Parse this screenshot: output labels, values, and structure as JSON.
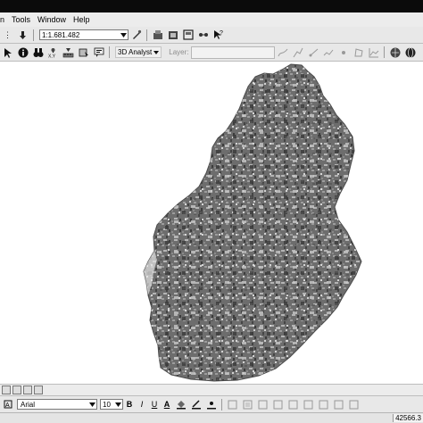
{
  "menu": {
    "items": [
      "n",
      "Tools",
      "Window",
      "Help"
    ]
  },
  "toolbar": {
    "scale_value": "1:1.681.482",
    "analyst_label": "3D Analyst",
    "layer_label": "Layer:"
  },
  "text_toolbar": {
    "font_value": "Arial",
    "size_value": "10",
    "bold": "B",
    "italic": "I",
    "underline": "U",
    "font_color_glyph": "A"
  },
  "status": {
    "coordinates": "42566.3"
  },
  "icons": {
    "colors": {
      "map_dark": "#3f3f3f",
      "map_mid": "#767676",
      "map_light": "#bdbdbd"
    }
  }
}
